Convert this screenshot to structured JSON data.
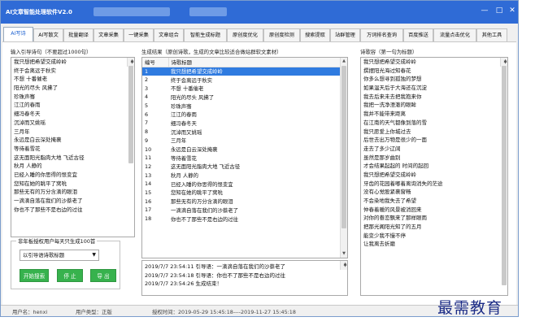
{
  "window": {
    "title": "AI文章智能处理软件V2.0"
  },
  "tabs": [
    {
      "label": "AI写诗"
    },
    {
      "label": "AI写散文"
    },
    {
      "label": "批量翻译"
    },
    {
      "label": "文章采集"
    },
    {
      "label": "一键采集"
    },
    {
      "label": "文章组合"
    },
    {
      "label": "智能生成标题"
    },
    {
      "label": "原创度优化"
    },
    {
      "label": "原创度检测"
    },
    {
      "label": "搜索提取"
    },
    {
      "label": "站群管理"
    },
    {
      "label": "万词排名查询"
    },
    {
      "label": "百度推送"
    },
    {
      "label": "流量点击优化"
    },
    {
      "label": "其他工具"
    }
  ],
  "input": {
    "label": "输入引导诗句（不要超过1000句）",
    "lines": [
      "我只想把希望交成岭岭",
      "终于会离远于秋实",
      "不想 十番催老",
      "阳光的尽头 风拂了",
      "珍珠声骞",
      "江江的春雨",
      "细冯春冬天",
      "沉淖而又姚瑶",
      "三月年",
      "永远是白云深处掩裹",
      "等待着雪花",
      "这无面阳光脂肉大地 飞近古径",
      "秋月 人静的",
      "已经入睡的你思得的恨变宜",
      "您知在她的眺平了窝吮",
      "那些无有的万分含滴的眼泪",
      "一滴滴自落在我们的沙蔡老了",
      "你也不了那些不是右边的过往"
    ]
  },
  "limit_group": {
    "title": "非年板授权用户每天只生成100首",
    "select_value": "以引导语诗歌标题"
  },
  "buttons": {
    "start": "开始搜索",
    "stop": "停 止",
    "export": "导 出"
  },
  "results": {
    "label": "生成结果（原创诗歌，生成的文章比较适合做站群软文素材）",
    "col_num": "编号",
    "col_title": "诗歌标题",
    "rows": [
      {
        "num": "1",
        "title": "我只想把希望交成岭岭"
      },
      {
        "num": "2",
        "title": "终于会离远于秋实"
      },
      {
        "num": "3",
        "title": "不想 十番催老"
      },
      {
        "num": "4",
        "title": "阳光的尽头 风拂了"
      },
      {
        "num": "5",
        "title": "珍珠声骞"
      },
      {
        "num": "6",
        "title": "江江的春雨"
      },
      {
        "num": "7",
        "title": "细冯春冬天"
      },
      {
        "num": "8",
        "title": "沉淖而又姚瑶"
      },
      {
        "num": "9",
        "title": "三月年"
      },
      {
        "num": "10",
        "title": "永远是白云深处掩裹"
      },
      {
        "num": "11",
        "title": "等待着雪花"
      },
      {
        "num": "12",
        "title": "这无面阳光脂肉大地 飞近古径"
      },
      {
        "num": "13",
        "title": "秋月 人静的"
      },
      {
        "num": "14",
        "title": "已经入睡的你思得的恨变宜"
      },
      {
        "num": "15",
        "title": "您知在她的眺平了窝吮"
      },
      {
        "num": "16",
        "title": "那些无有的万分含滴的眼泪"
      },
      {
        "num": "17",
        "title": "一滴滴自落在我们的沙蔡老了"
      },
      {
        "num": "18",
        "title": "你也不了那些不是右边的过往"
      }
    ]
  },
  "log": [
    "2019/7/7 23:54:11 引导语：一滴滴自落在我们的沙蔡老了",
    "2019/7/7 23:54:18 引导语：你也不了那些不是右边的过往",
    "2019/7/7 23:54:26 生成结束！"
  ],
  "poem": {
    "label": "诗歌容（第一句为标题）",
    "lines": [
      "我只想把希望交成岭岭",
      "撰摆阳光海过知春花",
      "你多么想寻到孤独的梦想",
      "如果温天后于大海还在沉淀",
      "我去后来未去把我抱来你",
      "我把一洗净澄澈的眼眸",
      "我并不能带来距离",
      "在江南的天气都像到落的雪",
      "我只愿爱上你城过去",
      "后世去出万物是很少的一面",
      "走去了多少辽阔",
      "虽然是那岁曲别",
      "才会结果起起的 时间的起回",
      "我只想把希望交成岭岭",
      "牙齿的花园着嘟着离询消失的茫途",
      "没有心觉股紧裹窗畅",
      "不会染地我失去了希望",
      "仲春着暖的风景被消回来",
      "对你的眷恋飘来了那样眼雨",
      "把那光阁阳光知了的五月",
      "能变少我不慢不停",
      "让我离去折磨"
    ]
  },
  "status": {
    "user": "用户名：henxi",
    "type": "用户类型：正版",
    "auth": "授权时间：2019-05-29 15:45:18----2019-11-27 15:45:18"
  },
  "watermark": "最需教育"
}
